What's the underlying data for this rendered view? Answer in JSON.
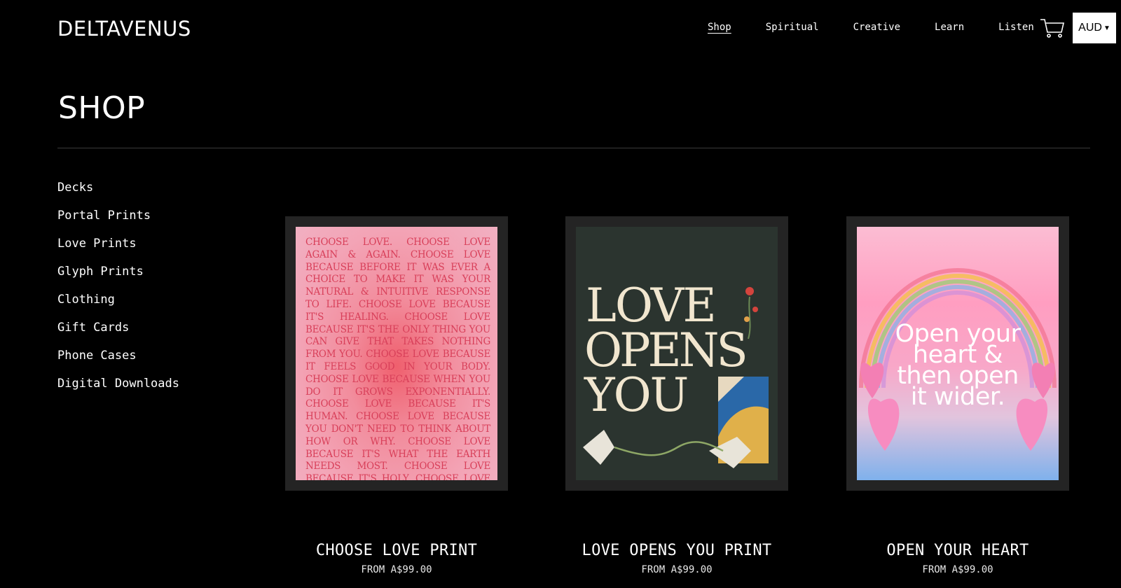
{
  "header": {
    "logo": "DELTAVENUS",
    "nav": [
      {
        "label": "Shop",
        "active": true
      },
      {
        "label": "Spiritual",
        "active": false
      },
      {
        "label": "Creative",
        "active": false
      },
      {
        "label": "Learn",
        "active": false
      },
      {
        "label": "Listen",
        "active": false
      }
    ],
    "cart_icon": "cart-icon",
    "currency": "AUD"
  },
  "page": {
    "title": "SHOP"
  },
  "sidebar": {
    "categories": [
      "Decks",
      "Portal Prints",
      "Love Prints",
      "Glyph Prints",
      "Clothing",
      "Gift Cards",
      "Phone Cases",
      "Digital Downloads"
    ]
  },
  "products": [
    {
      "name": "CHOOSE LOVE PRINT",
      "price": "FROM A$99.00",
      "art_text": "CHOOSE LOVE. CHOOSE LOVE AGAIN & AGAIN. CHOOSE LOVE BECAUSE BEFORE IT WAS EVER A CHOICE TO MAKE IT WAS YOUR NATURAL & INTUITIVE RESPONSE TO LIFE. CHOOSE LOVE BECAUSE IT'S HEALING. CHOOSE LOVE BECAUSE IT'S THE ONLY THING YOU CAN GIVE THAT TAKES NOTHING FROM YOU. CHOOSE LOVE BECAUSE IT FEELS GOOD IN YOUR BODY. CHOOSE LOVE BECAUSE WHEN YOU DO IT GROWS EXPONENTIALLY. CHOOSE LOVE BECAUSE IT'S HUMAN. CHOOSE LOVE BECAUSE YOU DON'T NEED TO THINK ABOUT HOW OR WHY. CHOOSE LOVE BECAUSE IT'S WHAT THE EARTH NEEDS MOST. CHOOSE LOVE BECAUSE IT'S HOLY. CHOOSE LOVE BECAUSE IT'S HOME. CHOOSE LOVE BECAUSE YOU ARE LOVE."
    },
    {
      "name": "LOVE OPENS YOU PRINT",
      "price": "FROM A$99.00",
      "art_lines": [
        "LOVE",
        "OPENS",
        "YOU"
      ]
    },
    {
      "name": "OPEN YOUR HEART",
      "price": "FROM A$99.00",
      "art_lines": [
        "Open your",
        "heart &",
        "then open",
        "it wider."
      ]
    }
  ]
}
